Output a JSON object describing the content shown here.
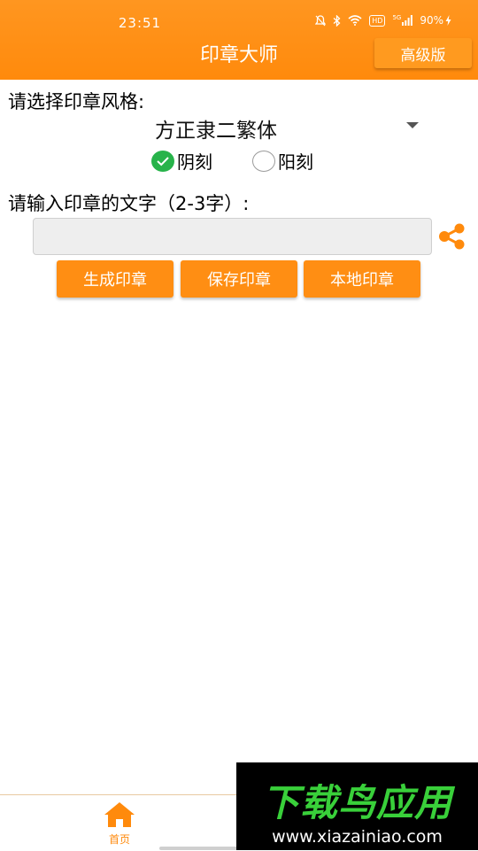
{
  "status_bar": {
    "time": "23:51",
    "hd": "HD",
    "network": "5G",
    "battery": "90%"
  },
  "header": {
    "title": "印章大师",
    "pro_label": "高级版"
  },
  "style_section": {
    "label": "请选择印章风格:",
    "font_value": "方正隶二繁体",
    "options": [
      {
        "label": "阴刻",
        "checked": true
      },
      {
        "label": "阳刻",
        "checked": false
      }
    ]
  },
  "input_section": {
    "label": "请输入印章的文字（2-3字）:",
    "value": "",
    "placeholder": ""
  },
  "actions": {
    "generate": "生成印章",
    "save": "保存印章",
    "local": "本地印章"
  },
  "bottom_nav": {
    "home_label": "首页"
  },
  "watermark": {
    "title": "下载鸟应用",
    "url": "www.xiazainiao.com"
  },
  "colors": {
    "accent": "#ff8a0c",
    "check_green": "#27b34a",
    "watermark_green": "#39d03a"
  }
}
